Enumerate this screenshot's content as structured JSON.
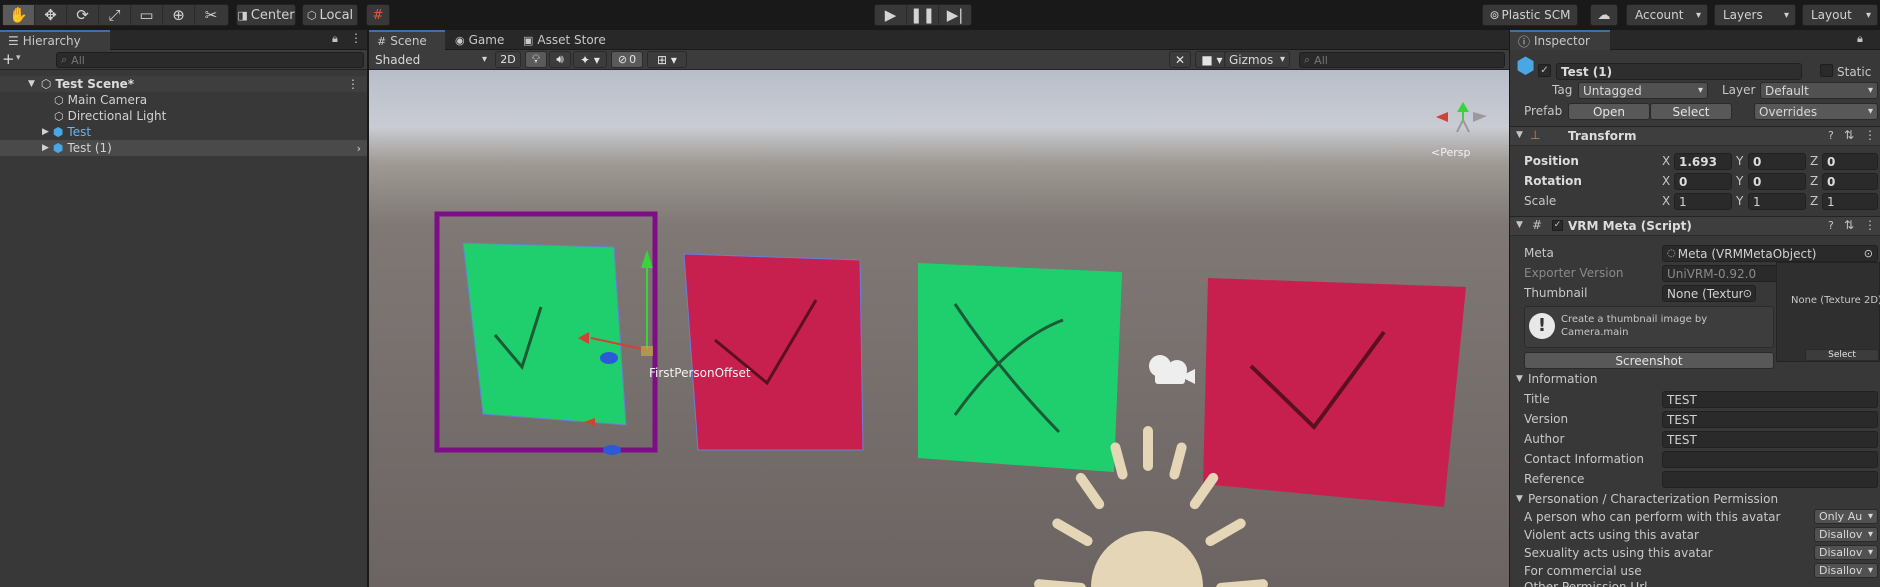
{
  "toolbar": {
    "pivot_label": "Center",
    "space_label": "Local",
    "plastic_label": "Plastic SCM",
    "account_label": "Account",
    "layers_label": "Layers",
    "layout_label": "Layout",
    "tool_icons": [
      "hand-icon",
      "move-icon",
      "rotate-icon",
      "scale-icon",
      "rect-icon",
      "transform-icon",
      "custom-tool-icon"
    ]
  },
  "hierarchy": {
    "tab": "Hierarchy",
    "search_placeholder": "All",
    "scene": "Test Scene*",
    "items": [
      "Main Camera",
      "Directional Light",
      "Test",
      "Test (1)"
    ]
  },
  "scene_view": {
    "tabs": [
      "Scene",
      "Game",
      "Asset Store"
    ],
    "shading": "Shaded",
    "mode_2d": "2D",
    "hidden_count": "0",
    "gizmos": "Gizmos",
    "search_placeholder": "All",
    "persp_label": "<Persp",
    "object_label": "FirstPersonOffset"
  },
  "inspector": {
    "tab": "Inspector",
    "object_name": "Test (1)",
    "static_label": "Static",
    "tag_label": "Tag",
    "tag_value": "Untagged",
    "layer_label": "Layer",
    "layer_value": "Default",
    "prefab_label": "Prefab",
    "prefab_open": "Open",
    "prefab_select": "Select",
    "prefab_overrides": "Overrides",
    "transform": {
      "title": "Transform",
      "position_label": "Position",
      "rotation_label": "Rotation",
      "scale_label": "Scale",
      "position": {
        "x": "1.693",
        "y": "0",
        "z": "0"
      },
      "rotation": {
        "x": "0",
        "y": "0",
        "z": "0"
      },
      "scale": {
        "x": "1",
        "y": "1",
        "z": "1"
      }
    },
    "vrm": {
      "title": "VRM Meta (Script)",
      "meta_label": "Meta",
      "meta_value": "Meta (VRMMetaObject)",
      "exporter_label": "Exporter Version",
      "exporter_value": "UniVRM-0.92.0",
      "thumbnail_label": "Thumbnail",
      "thumbnail_value": "None (Texture",
      "preview_label": "None (Texture 2D)",
      "preview_select": "Select",
      "help_text": "Create a thumbnail image by Camera.main",
      "screenshot_button": "Screenshot",
      "information_label": "Information",
      "title_label": "Title",
      "title_value": "TEST",
      "version_label": "Version",
      "version_value": "TEST",
      "author_label": "Author",
      "author_value": "TEST",
      "contact_label": "Contact Information",
      "contact_value": "",
      "reference_label": "Reference",
      "reference_value": "",
      "permission_label": "Personation / Characterization Permission",
      "perm_perform_label": "A person who can perform with this avatar",
      "perm_perform_value": "Only Au",
      "perm_violent_label": "Violent acts using this avatar",
      "perm_violent_value": "Disallov",
      "perm_sexual_label": "Sexuality acts using this avatar",
      "perm_sexual_value": "Disallov",
      "perm_commercial_label": "For commercial use",
      "perm_commercial_value": "Disallov",
      "perm_other_label": "Other Permission Url"
    }
  },
  "colors": {
    "green_card": "#1fcf6e",
    "red_card": "#c8204e",
    "selection": "#7d0e86",
    "sun": "#e4d6b6"
  }
}
